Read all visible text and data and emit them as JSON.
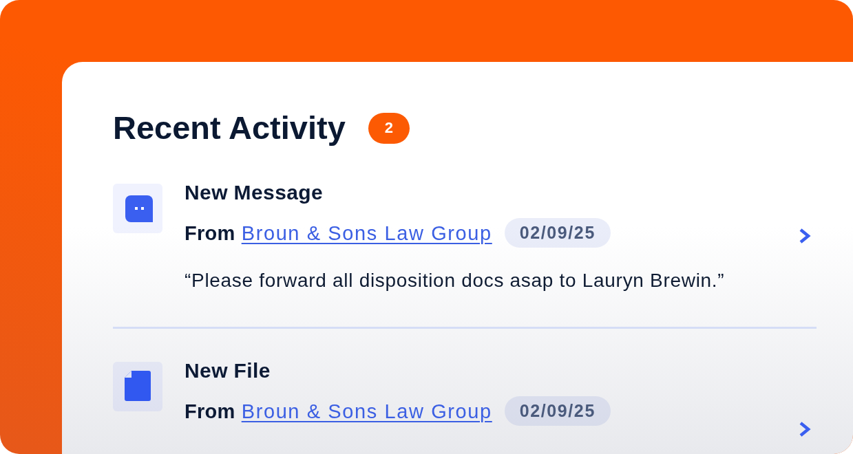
{
  "panel": {
    "title": "Recent Activity",
    "badge": "2"
  },
  "items": [
    {
      "kind": "message",
      "title": "New Message",
      "from_label": "From",
      "sender": "Broun & Sons Law Group",
      "date": "02/09/25",
      "preview": "“Please forward all disposition docs asap to Lauryn Brewin.”"
    },
    {
      "kind": "file",
      "title": "New File",
      "from_label": "From",
      "sender": "Broun & Sons Law Group",
      "date": "02/09/25"
    }
  ]
}
